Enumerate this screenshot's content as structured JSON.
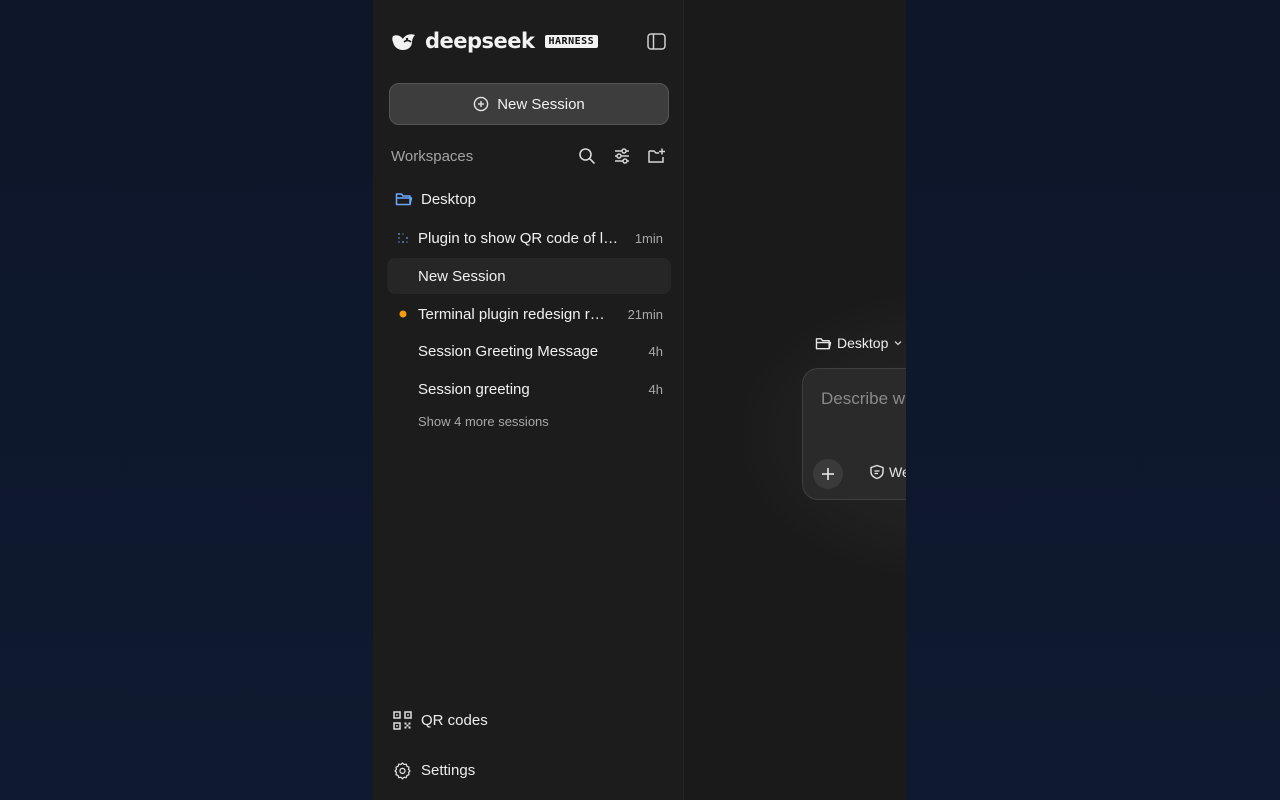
{
  "brand": {
    "name": "deepseek",
    "badge": "HARNESS"
  },
  "sidebar": {
    "new_session_label": "New Session",
    "workspaces_label": "Workspaces",
    "folder": {
      "name": "Desktop",
      "icon": "folder-icon"
    },
    "sessions": [
      {
        "title": "Plugin to show QR code of l…",
        "time": "1min",
        "status": "loading",
        "active": false
      },
      {
        "title": "New Session",
        "time": "",
        "status": "none",
        "active": true
      },
      {
        "title": "Terminal plugin redesign r…",
        "time": "21min",
        "status": "unread",
        "active": false
      },
      {
        "title": "Session Greeting Message",
        "time": "4h",
        "status": "none",
        "active": false
      },
      {
        "title": "Session greeting",
        "time": "4h",
        "status": "none",
        "active": false
      }
    ],
    "show_more_label": "Show 4 more sessions",
    "bottom": {
      "qr_label": "QR codes",
      "settings_label": "Settings"
    }
  },
  "main": {
    "workspace_picker_label": "Desktop",
    "composer": {
      "placeholder": "Describe w",
      "permission_label": "We"
    }
  },
  "colors": {
    "unread_dot": "#f59e0b",
    "folder_icon": "#6ea8fe",
    "loading_dots": "#6b7fbf"
  }
}
